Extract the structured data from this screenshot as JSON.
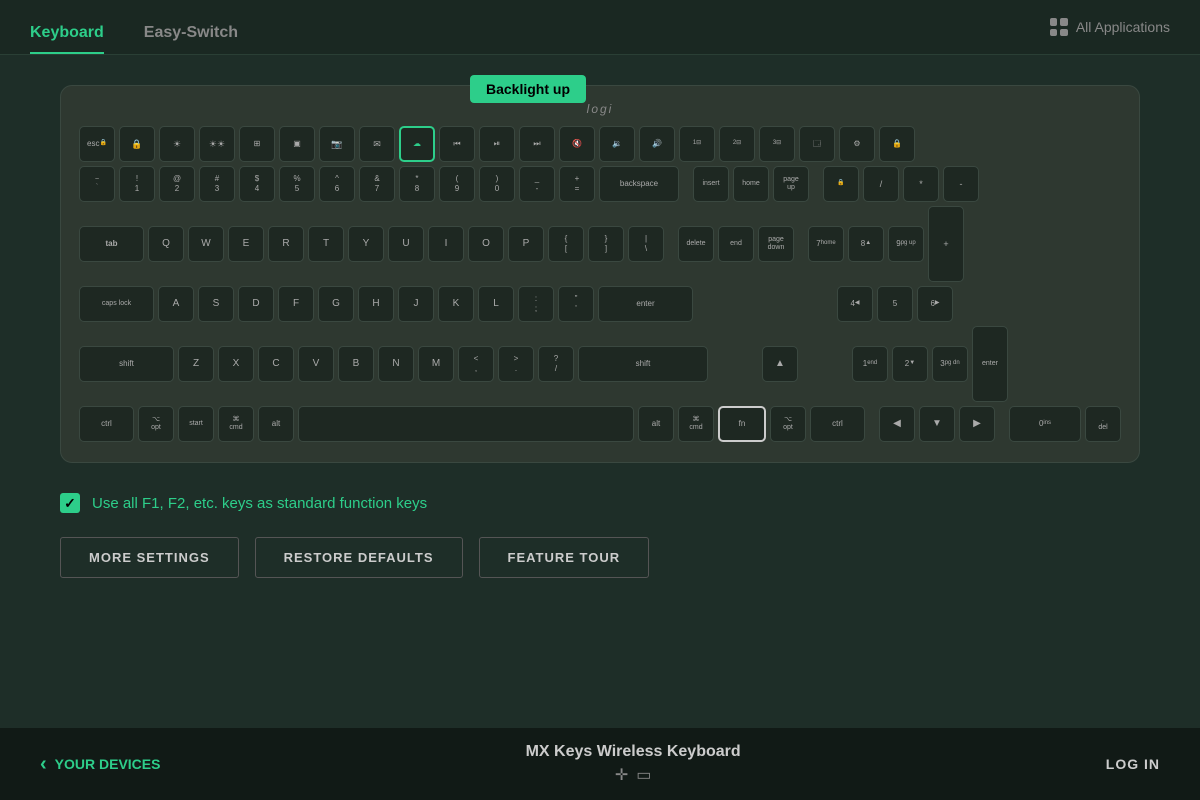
{
  "header": {
    "tab_keyboard": "Keyboard",
    "tab_easyswitch": "Easy-Switch",
    "all_applications_label": "All Applications"
  },
  "keyboard": {
    "brand": "logi",
    "tooltip": "Backlight up",
    "rows": {
      "fn_row": [
        "esc",
        "",
        "☀",
        "☀",
        "⊞",
        "▣",
        "📷",
        "✉",
        "☁",
        "◀◀",
        "⏯",
        "▶▶",
        "🔇",
        "🔉",
        "🔊",
        "1⊟",
        "2⊟",
        "3⊟",
        "🗔",
        "⚙",
        "🔒"
      ],
      "num_row": [
        "~\n`",
        "!\n1",
        "@\n2",
        "#\n3",
        "$\n4",
        "%\n5",
        "^\n6",
        "&\n7",
        "*\n8",
        "(\n9",
        ")\n0",
        "-\n_",
        "=\n+",
        "backspace"
      ],
      "tab_row": [
        "tab",
        "Q",
        "W",
        "E",
        "R",
        "T",
        "Y",
        "U",
        "I",
        "O",
        "P",
        "{\n[",
        "}\n]",
        "|\n\\"
      ],
      "caps_row": [
        "caps lock",
        "A",
        "S",
        "D",
        "F",
        "G",
        "H",
        "J",
        "K",
        "L",
        ":\n;",
        "'\n\"",
        "enter"
      ],
      "shift_row": [
        "shift",
        "Z",
        "X",
        "C",
        "V",
        "B",
        "N",
        "M",
        "<\n,",
        ">\n.",
        "?\n/",
        "shift"
      ],
      "ctrl_row": [
        "ctrl",
        "opt",
        "start",
        "⌘\ncmd",
        "alt",
        "",
        "alt",
        "⌘\ncmd",
        "opt",
        "ctrl"
      ]
    }
  },
  "checkbox": {
    "label": "Use all F1, F2, etc. keys as standard function keys",
    "checked": true
  },
  "buttons": {
    "more_settings": "MORE SETTINGS",
    "restore_defaults": "RESTORE DEFAULTS",
    "feature_tour": "FEATURE TOUR"
  },
  "footer": {
    "your_devices": "YOUR DEVICES",
    "device_name": "MX Keys Wireless Keyboard",
    "log_in": "LOG IN"
  }
}
